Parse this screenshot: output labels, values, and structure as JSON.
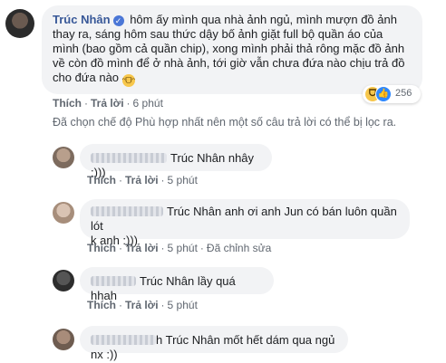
{
  "post_comment": {
    "author": "Trúc Nhân",
    "text": "hôm ấy mình qua nhà ảnh ngủ, mình mượn đồ ảnh thay ra, sáng hôm sau thức dậy bố ảnh giặt full bộ quần áo của mình (bao gồm cả quần chip), xong mình phải thả rông mặc đồ ảnh về còn đồ mình để ở nhà ảnh, tới giờ vẫn chưa đứa nào chịu trả đồ cho đứa nào",
    "like": "Thích",
    "reply": "Trả lời",
    "time": "6 phút",
    "reaction_count": "256"
  },
  "filter_notice": "Đã chọn chế độ Phù hợp nhất nên một số câu trả lời có thể bị lọc ra.",
  "replies": [
    {
      "mention": "Trúc Nhân",
      "text": "nhây :)))",
      "like": "Thích",
      "reply": "Trả lời",
      "time": "5 phút"
    },
    {
      "mention": "Trúc Nhân",
      "text_line1": "anh ơi anh Jun có bán luôn quần lót",
      "text_line2": "k anh :)))",
      "like": "Thích",
      "reply": "Trả lời",
      "time": "5 phút",
      "edited": "Đã chỉnh sửa"
    },
    {
      "mention": "Trúc Nhân",
      "text": "lầy quá hhah",
      "like": "Thích",
      "reply": "Trả lời",
      "time": "5 phút"
    },
    {
      "name_tail": "h",
      "mention": "Trúc Nhân",
      "text": "mốt hết dám qua ngủ nx :))",
      "like": "Thích",
      "reply": "Trả lời",
      "time": "5 phút"
    }
  ]
}
